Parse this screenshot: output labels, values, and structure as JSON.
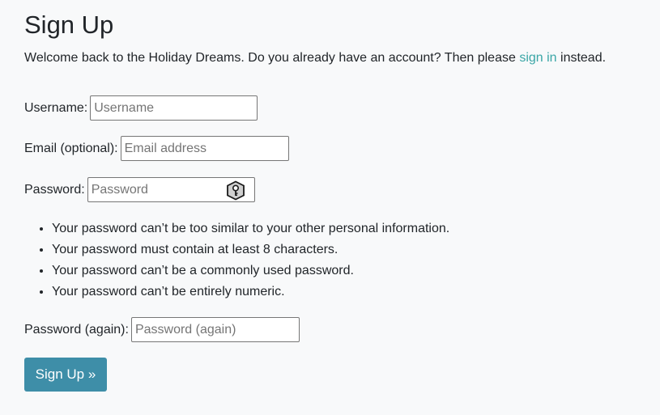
{
  "page": {
    "title": "Sign Up",
    "welcome_prefix": "Welcome back to the Holiday Dreams. Do you already have an account? Then please ",
    "welcome_link": "sign in",
    "welcome_suffix": " instead."
  },
  "form": {
    "username": {
      "label": "Username:",
      "placeholder": "Username",
      "value": ""
    },
    "email": {
      "label": "Email (optional):",
      "placeholder": "Email address",
      "value": ""
    },
    "password": {
      "label": "Password:",
      "placeholder": "Password",
      "value": "",
      "icon": "password-manager-key-icon"
    },
    "password_rules": [
      "Your password can’t be too similar to your other personal information.",
      "Your password must contain at least 8 characters.",
      "Your password can’t be a commonly used password.",
      "Your password can’t be entirely numeric."
    ],
    "password_again": {
      "label": "Password (again):",
      "placeholder": "Password (again)",
      "value": ""
    },
    "submit_label": "Sign Up »"
  },
  "colors": {
    "background": "#f8f9fa",
    "link": "#3aa6a6",
    "button": "#3e8ea8"
  }
}
